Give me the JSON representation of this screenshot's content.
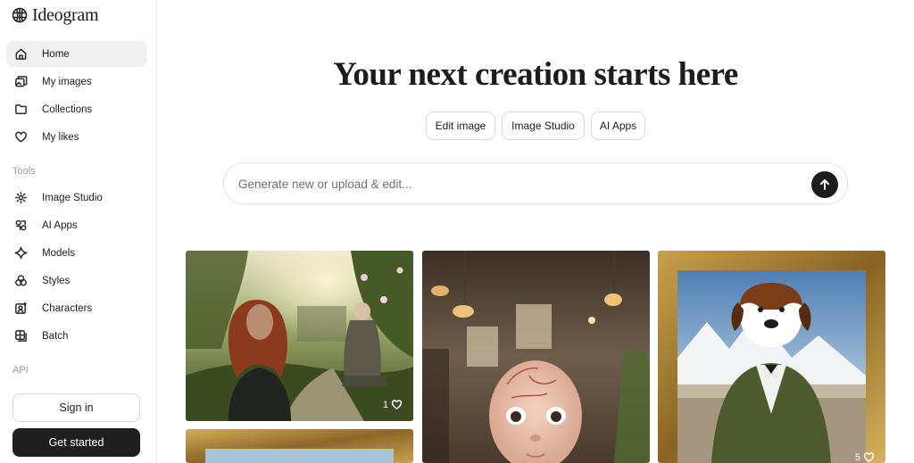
{
  "app": {
    "name": "Ideogram"
  },
  "sidebar": {
    "nav": [
      {
        "label": "Home",
        "icon": "home-icon",
        "active": true
      },
      {
        "label": "My images",
        "icon": "images-icon"
      },
      {
        "label": "Collections",
        "icon": "folder-icon"
      },
      {
        "label": "My likes",
        "icon": "heart-icon"
      }
    ],
    "tools_label": "Tools",
    "tools": [
      {
        "label": "Image Studio",
        "icon": "gear-icon"
      },
      {
        "label": "AI Apps",
        "icon": "apps-icon"
      },
      {
        "label": "Models",
        "icon": "sparkle-icon"
      },
      {
        "label": "Styles",
        "icon": "styles-icon"
      },
      {
        "label": "Characters",
        "icon": "character-icon"
      },
      {
        "label": "Batch",
        "icon": "batch-icon"
      }
    ],
    "api_label": "API",
    "sign_in": "Sign in",
    "get_started": "Get started"
  },
  "main": {
    "title": "Your next creation starts here",
    "quick_actions": [
      "Edit image",
      "Image Studio",
      "AI Apps"
    ],
    "prompt_placeholder": "Generate new or upload & edit..."
  },
  "gallery": [
    {
      "name": "garden-women-image",
      "likes": "1"
    },
    {
      "name": "baby-portrait-image",
      "likes": ""
    },
    {
      "name": "dog-portrait-image",
      "likes": "5"
    },
    {
      "name": "framed-landscape-image",
      "likes": ""
    }
  ],
  "colors": {
    "accent": "#1f1f1f",
    "active_bg": "#f0f0f0",
    "border": "#d9d9d9"
  }
}
